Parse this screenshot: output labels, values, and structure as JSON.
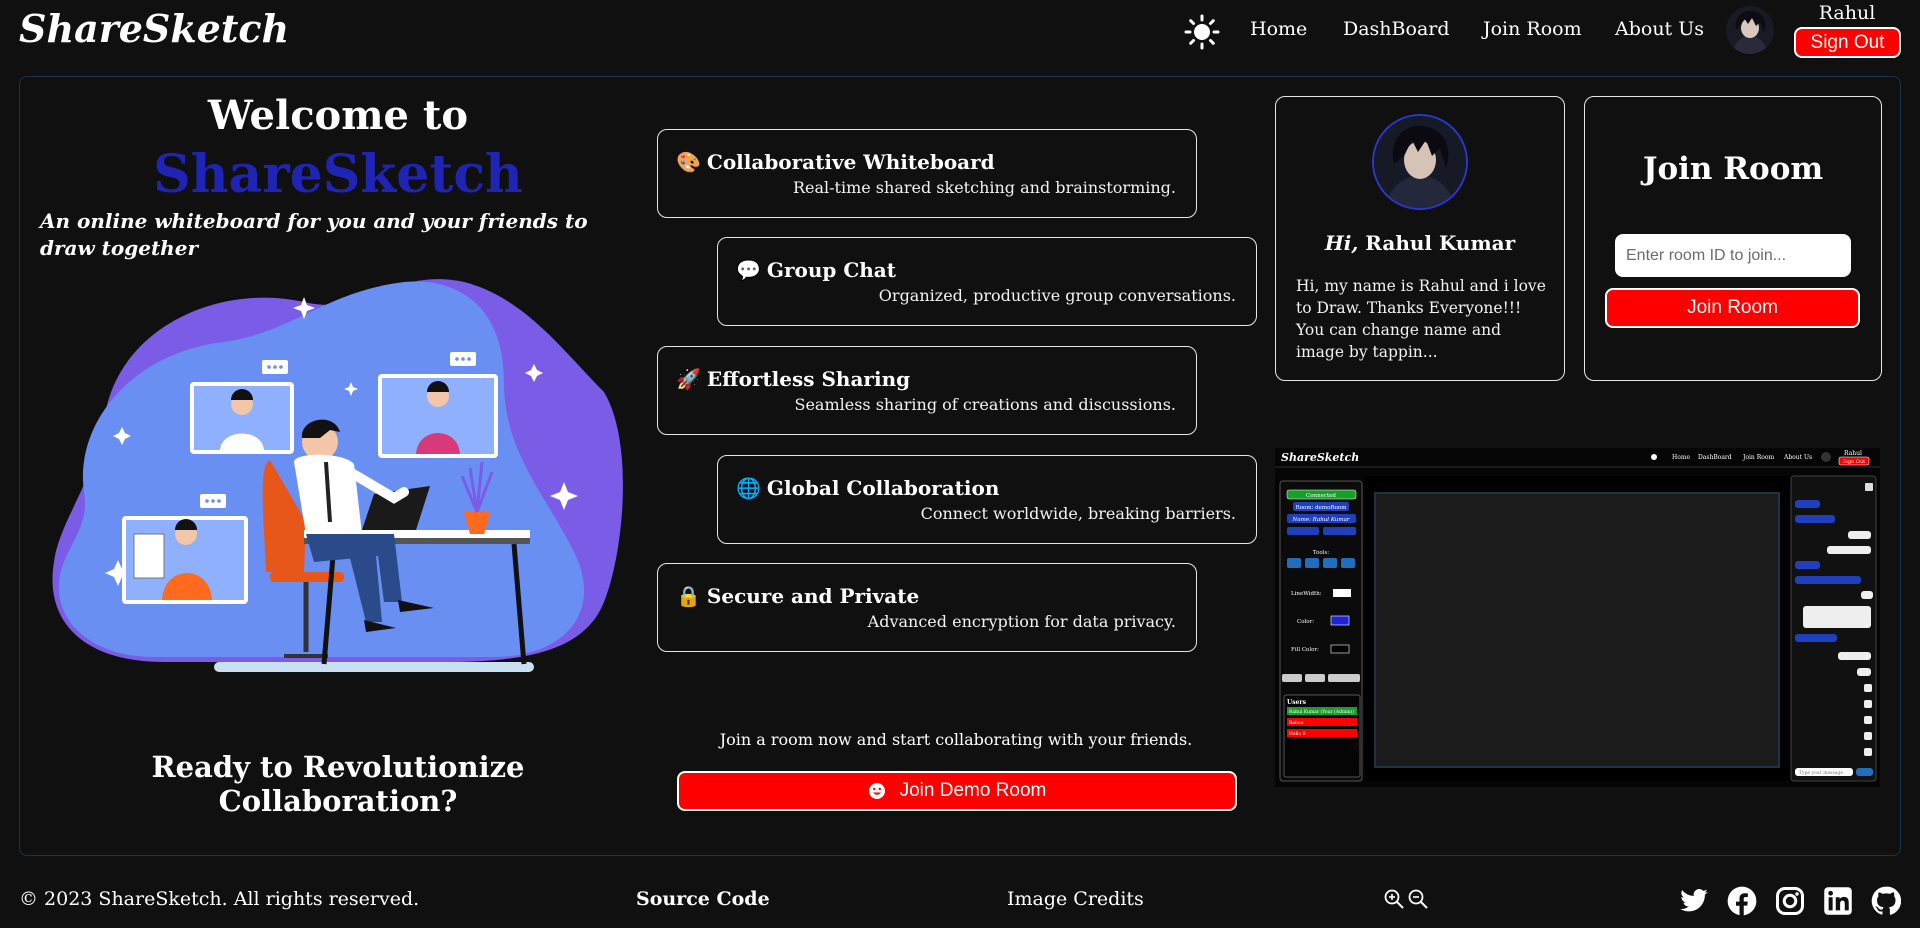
{
  "nav": {
    "brand": "ShareSketch",
    "links": [
      "Home",
      "DashBoard",
      "Join Room",
      "About Us"
    ],
    "user_name": "Rahul",
    "sign_out": "Sign Out"
  },
  "hero": {
    "welcome": "Welcome to",
    "brand": "ShareSketch",
    "tagline": "An online whiteboard for you and your friends to draw together",
    "ready": "Ready to Revolutionize Collaboration?"
  },
  "features": [
    {
      "icon": "🎨",
      "title": "Collaborative Whiteboard",
      "desc": "Real-time shared sketching and brainstorming."
    },
    {
      "icon": "💬",
      "title": "Group Chat",
      "desc": "Organized, productive group conversations."
    },
    {
      "icon": "🚀",
      "title": "Effortless Sharing",
      "desc": "Seamless sharing of creations and discussions."
    },
    {
      "icon": "🌐",
      "title": "Global Collaboration",
      "desc": "Connect worldwide, breaking barriers."
    },
    {
      "icon": "🔒",
      "title": "Secure and Private",
      "desc": "Advanced encryption for data privacy."
    }
  ],
  "cta": {
    "text": "Join a room now and start collaborating with your friends.",
    "button": "Join Demo Room"
  },
  "profile": {
    "hi": "Hi,",
    "name": "Rahul Kumar",
    "bio": "Hi, my name is Rahul and i love to Draw. Thanks Everyone!!! You can change name and image by tappin..."
  },
  "join": {
    "title": "Join Room",
    "placeholder": "Enter room ID to join...",
    "button": "Join Room"
  },
  "preview": {
    "brand": "ShareSketch",
    "links": [
      "Home",
      "DashBoard",
      "Join Room",
      "About Us"
    ],
    "user": "Rahul",
    "sign_out": "Sign Out",
    "connected": "Connected",
    "room": "Room: demoRoom",
    "name": "Name: Rahul Kumar",
    "tools_label": "Tools:",
    "linewidth_label": "LineWidth:",
    "color_label": "Color:",
    "fill_label": "Fill Color:",
    "users_label": "Users",
    "users": [
      "Rahul Kumar (Your (Admin))",
      "Rohan",
      "Hello 0"
    ],
    "chat_placeholder": "Type your message"
  },
  "footer": {
    "copyright": "© 2023 ShareSketch. All rights reserved.",
    "source": "Source Code",
    "credits": "Image Credits",
    "zoom_icons": [
      "zoom-in-icon",
      "zoom-out-icon"
    ],
    "social_icons": [
      "twitter-icon",
      "facebook-icon",
      "instagram-icon",
      "linkedin-icon",
      "github-icon"
    ]
  },
  "colors": {
    "background": "#101010",
    "accent_red": "#ff0000",
    "brand_blue": "#1f24b5"
  }
}
